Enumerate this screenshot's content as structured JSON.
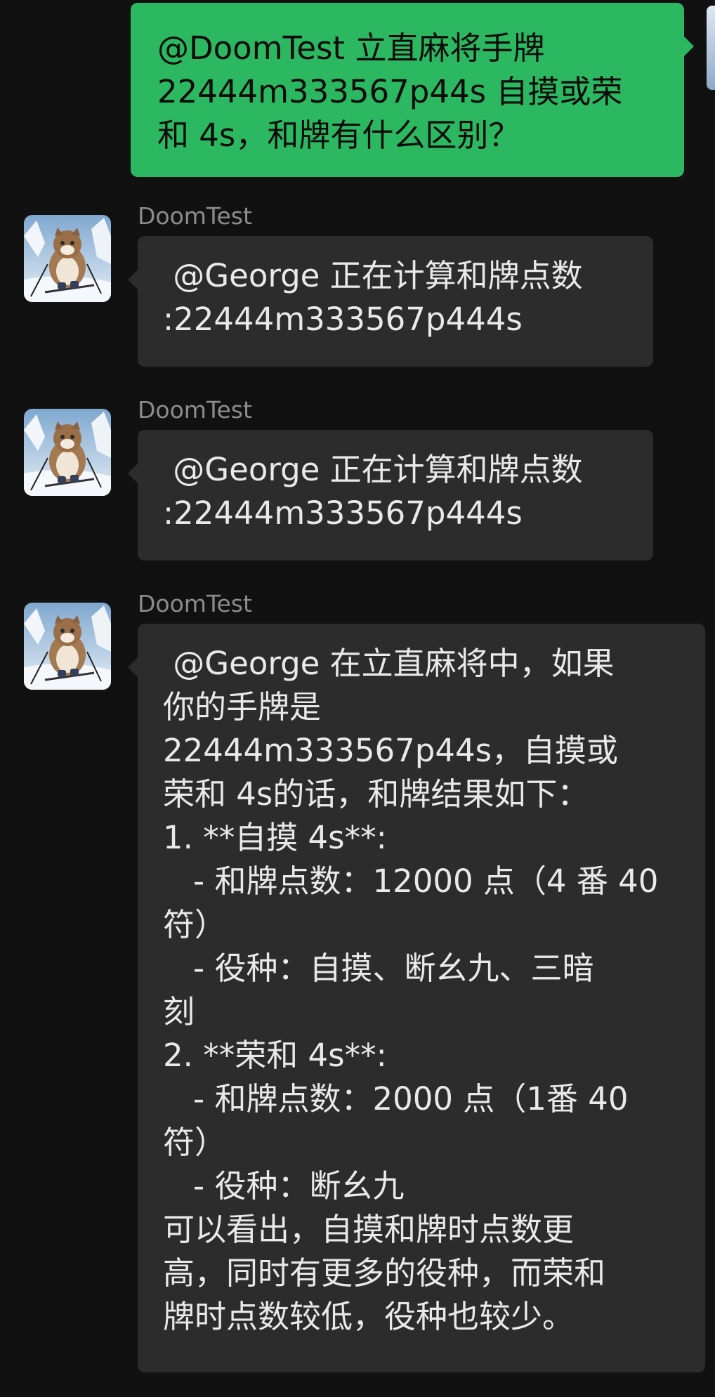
{
  "outgoing": {
    "lines": [
      "@DoomTest 立直麻将手牌",
      "22444m333567p44s 自摸或荣",
      "和 4s，和牌有什么区别？"
    ]
  },
  "incoming": [
    {
      "sender": "DoomTest",
      "lines": [
        " @George 正在计算和牌点数",
        ":22444m333567p444s"
      ]
    },
    {
      "sender": "DoomTest",
      "lines": [
        " @George 正在计算和牌点数",
        ":22444m333567p444s"
      ]
    },
    {
      "sender": "DoomTest",
      "lines": [
        " @George 在立直麻将中，如果",
        "你的手牌是",
        "22444m333567p44s，自摸或",
        "荣和 4s的话，和牌结果如下：",
        "1. **自摸 4s**:",
        "   - 和牌点数：12000 点（4 番 40",
        "符）",
        "   - 役种：自摸、断幺九、三暗",
        "刻",
        "2. **荣和 4s**:",
        "   - 和牌点数：2000 点（1番 40",
        "符）",
        "   - 役种：断幺九",
        "可以看出，自摸和牌时点数更",
        "高，同时有更多的役种，而荣和",
        "牌时点数较低，役种也较少。"
      ]
    }
  ],
  "colors": {
    "background": "#111111",
    "outgoing_bubble": "#2bb861",
    "incoming_bubble": "#2c2c2c",
    "sender_name": "#8c8c8c"
  },
  "icons": {
    "bot_avatar": "cat-skier-avatar-icon",
    "self_avatar": "user-avatar-icon"
  }
}
